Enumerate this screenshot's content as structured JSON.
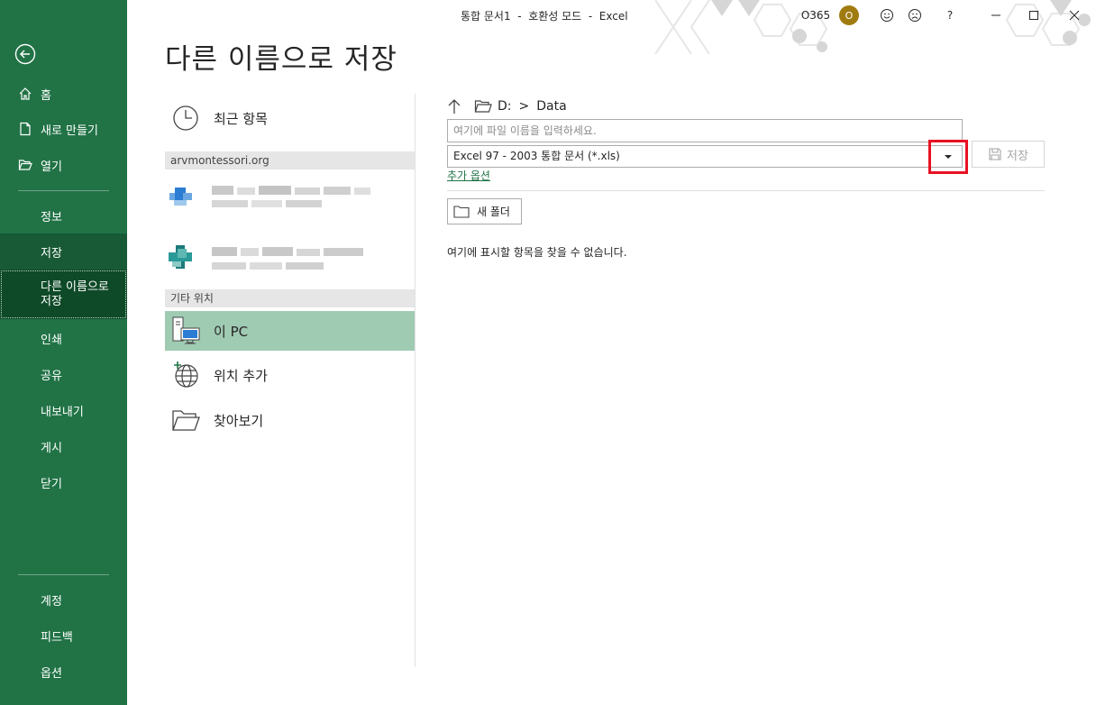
{
  "window": {
    "title": "통합 문서1  -  호환성 모드  -  Excel",
    "account": "O365",
    "avatar_initial": "O",
    "help": "?"
  },
  "sidebar": {
    "nav_top": [
      "홈",
      "새로 만들기",
      "열기"
    ],
    "nav_mid": [
      "정보",
      "저장",
      "다른 이름으로\n저장",
      "인쇄",
      "공유",
      "내보내기",
      "게시",
      "닫기"
    ],
    "nav_bottom": [
      "계정",
      "피드백",
      "옵션"
    ]
  },
  "page": {
    "title": "다른 이름으로 저장"
  },
  "locations": {
    "recent": "최근 항목",
    "group_org": "arvmontessori.org",
    "group_other": "기타 위치",
    "this_pc": "이 PC",
    "add_place": "위치 추가",
    "browse": "찾아보기"
  },
  "save_pane": {
    "path_drive": "D:",
    "path_sep": ">",
    "path_folder": "Data",
    "filename_placeholder": "여기에 파일 이름을 입력하세요.",
    "file_type": "Excel 97 - 2003 통합 문서 (*.xls)",
    "save_label": "저장",
    "more_options": "추가 옵션",
    "new_folder": "새 폴더",
    "empty_message": "여기에 표시할 항목을 찾을 수 없습니다."
  },
  "colors": {
    "sidebar": "#217346",
    "sidebar_selected": "#0f4a28",
    "location_selected": "#a0cbb3",
    "highlight": "#e81123"
  }
}
